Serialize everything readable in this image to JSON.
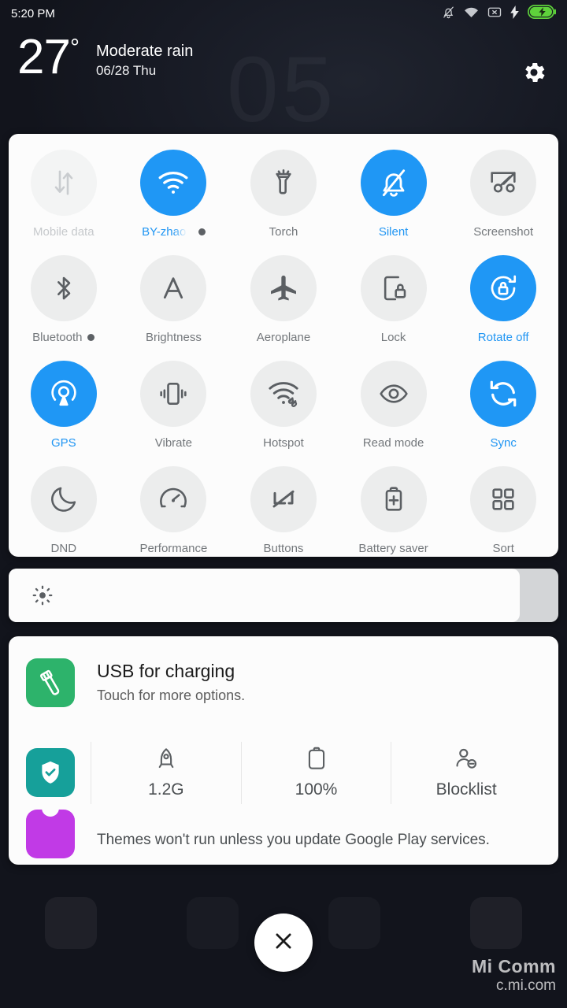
{
  "status_bar": {
    "time": "5:20 PM",
    "icons": [
      {
        "name": "notifications-off-icon"
      },
      {
        "name": "wifi-icon"
      },
      {
        "name": "no-sim-icon"
      },
      {
        "name": "charging-bolt-icon"
      },
      {
        "name": "battery-charging-icon"
      }
    ],
    "battery_color": "#5ed13b"
  },
  "header": {
    "temperature": "27",
    "degree": "°",
    "condition": "Moderate rain",
    "date": "06/28 Thu",
    "settings_icon": "gear-icon",
    "wallpaper_clock": "05"
  },
  "quick_settings": {
    "accent_on": "#1f97f5",
    "tile_bg": "#eceded",
    "tiles": [
      {
        "label": "Mobile data",
        "icon": "mobile-data-icon",
        "state": "disabled",
        "dot": false
      },
      {
        "label": "BY-zhaop",
        "icon": "wifi-icon",
        "state": "on",
        "dot": true
      },
      {
        "label": "Torch",
        "icon": "torch-icon",
        "state": "off",
        "dot": false
      },
      {
        "label": "Silent",
        "icon": "bell-off-icon",
        "state": "on",
        "dot": false
      },
      {
        "label": "Screenshot",
        "icon": "scissors-icon",
        "state": "off",
        "dot": false
      },
      {
        "label": "Bluetooth",
        "icon": "bluetooth-icon",
        "state": "off",
        "dot": true
      },
      {
        "label": "Brightness",
        "icon": "auto-brightness-icon",
        "state": "off",
        "dot": false
      },
      {
        "label": "Aeroplane",
        "icon": "airplane-icon",
        "state": "off",
        "dot": false
      },
      {
        "label": "Lock",
        "icon": "screen-lock-icon",
        "state": "off",
        "dot": false
      },
      {
        "label": "Rotate off",
        "icon": "rotate-lock-icon",
        "state": "on",
        "dot": false
      },
      {
        "label": "GPS",
        "icon": "location-icon",
        "state": "on",
        "dot": false
      },
      {
        "label": "Vibrate",
        "icon": "vibrate-icon",
        "state": "off",
        "dot": false
      },
      {
        "label": "Hotspot",
        "icon": "hotspot-icon",
        "state": "off",
        "dot": false
      },
      {
        "label": "Read mode",
        "icon": "eye-icon",
        "state": "off",
        "dot": false
      },
      {
        "label": "Sync",
        "icon": "sync-icon",
        "state": "on",
        "dot": false
      },
      {
        "label": "DND",
        "icon": "moon-icon",
        "state": "off",
        "dot": false
      },
      {
        "label": "Performance",
        "icon": "speedometer-icon",
        "state": "off",
        "dot": false
      },
      {
        "label": "Buttons",
        "icon": "buttons-icon",
        "state": "off",
        "dot": false
      },
      {
        "label": "Battery saver",
        "icon": "battery-plus-icon",
        "state": "off",
        "dot": false
      },
      {
        "label": "Sort",
        "icon": "grid-icon",
        "state": "off",
        "dot": false
      }
    ]
  },
  "brightness": {
    "icon": "brightness-sun-icon",
    "level_percent": 93
  },
  "notifications": {
    "usb": {
      "icon": "usb-icon",
      "icon_color": "#2db36b",
      "title": "USB for charging",
      "subtitle": "Touch for more options."
    },
    "security": {
      "icon": "shield-check-icon",
      "icon_color": "#16a09a",
      "stats": [
        {
          "icon": "rocket-icon",
          "value": "1.2G",
          "name": "memory-cleaner"
        },
        {
          "icon": "battery-icon",
          "value": "100%",
          "name": "battery-status"
        },
        {
          "icon": "person-block-icon",
          "value": "Blocklist",
          "name": "blocklist"
        }
      ]
    },
    "themes": {
      "icon": "themes-icon",
      "icon_color": "#c13ae6",
      "text": "Themes won't run unless you update Google Play services."
    }
  },
  "close_button": {
    "icon": "close-icon",
    "label": "×"
  },
  "watermark": {
    "line1": "Mi Comm",
    "line2": "c.mi.com"
  }
}
